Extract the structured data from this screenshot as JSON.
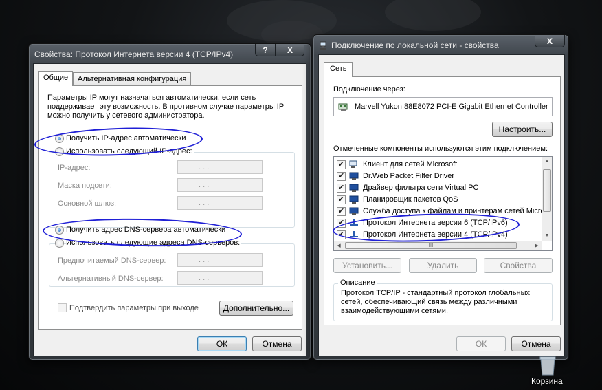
{
  "desktop": {
    "recycle_bin_label": "Корзина"
  },
  "left_window": {
    "title": "Свойства: Протокол Интернета версии 4 (TCP/IPv4)",
    "help_label": "?",
    "close_label": "X",
    "tabs": [
      "Общие",
      "Альтернативная конфигурация"
    ],
    "description": "Параметры IP могут назначаться автоматически, если сеть поддерживает эту возможность. В противном случае параметры IP можно получить у сетевого администратора.",
    "ip_auto_label": "Получить IP-адрес автоматически",
    "ip_manual_label": "Использовать следующий IP-адрес:",
    "ip_fields": [
      {
        "label": "IP-адрес:",
        "value": ".      .      ."
      },
      {
        "label": "Маска подсети:",
        "value": ".      .      ."
      },
      {
        "label": "Основной шлюз:",
        "value": ".      .      ."
      }
    ],
    "dns_auto_label": "Получить адрес DNS-сервера автоматически",
    "dns_manual_label": "Использовать следующие адреса DNS-серверов:",
    "dns_fields": [
      {
        "label": "Предпочитаемый DNS-сервер:",
        "value": ".      .      ."
      },
      {
        "label": "Альтернативный DNS-сервер:",
        "value": ".      .      ."
      }
    ],
    "validate_label": "Подтвердить параметры при выходе",
    "advanced_button": "Дополнительно...",
    "ok_button": "ОК",
    "cancel_button": "Отмена"
  },
  "right_window": {
    "title": "Подключение по локальной сети - свойства",
    "close_label": "X",
    "tab": "Сеть",
    "connect_via_label": "Подключение через:",
    "adapter_name": "Marvell Yukon 88E8072 PCI-E Gigabit Ethernet Controller",
    "configure_button": "Настроить...",
    "components_label": "Отмеченные компоненты используются этим подключением:",
    "components": [
      {
        "label": "Клиент для сетей Microsoft",
        "checked": true
      },
      {
        "label": "Dr.Web Packet Filter Driver",
        "checked": true
      },
      {
        "label": "Драйвер фильтра сети Virtual PC",
        "checked": true
      },
      {
        "label": "Планировщик пакетов QoS",
        "checked": true
      },
      {
        "label": "Служба доступа к файлам и принтерам сетей Micro",
        "checked": true
      },
      {
        "label": "Протокол Интернета версии 6 (TCP/IPv6)",
        "checked": true
      },
      {
        "label": "Протокол Интернета версии 4 (TCP/IPv4)",
        "checked": true
      }
    ],
    "hscroll_grip": "III",
    "install_button": "Установить...",
    "remove_button": "Удалить",
    "properties_button": "Свойства",
    "description_title": "Описание",
    "description_text": "Протокол TCP/IP - стандартный протокол глобальных сетей, обеспечивающий связь между различными взаимодействующими сетями.",
    "ok_button": "ОК",
    "cancel_button": "Отмена"
  },
  "colors": {
    "annotation": "#1f1fd6",
    "window_frame": "#3f454c",
    "dialog_bg": "#f0f0f0"
  }
}
